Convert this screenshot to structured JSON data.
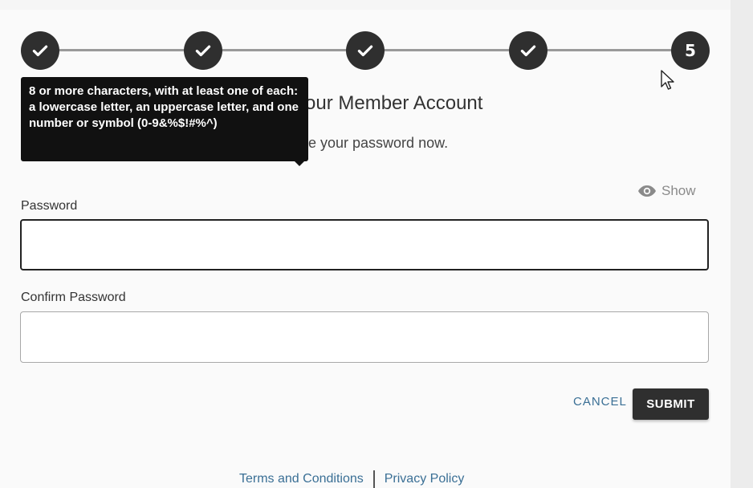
{
  "stepper": {
    "steps": [
      {
        "state": "complete",
        "icon": "check-icon"
      },
      {
        "state": "complete",
        "icon": "check-icon"
      },
      {
        "state": "complete",
        "icon": "check-icon"
      },
      {
        "state": "complete",
        "icon": "check-icon"
      },
      {
        "state": "current",
        "label": "5"
      }
    ]
  },
  "tooltip": {
    "text": "8 or more characters, with at least one of each: a lowercase letter, an uppercase letter, and one number or symbol (0-9&%$!#%^)"
  },
  "page": {
    "heading": "our Member Account",
    "subtext": "e your password now."
  },
  "form": {
    "show_label": "Show",
    "password_label": "Password",
    "password_value": "",
    "confirm_label": "Confirm Password",
    "confirm_value": "",
    "cancel_label": "CANCEL",
    "submit_label": "SUBMIT"
  },
  "footer": {
    "terms": "Terms and Conditions",
    "privacy": "Privacy Policy"
  },
  "colors": {
    "accent_link": "#3a6f95",
    "step_fill": "#2f2f2f",
    "tooltip_bg": "#111111"
  }
}
